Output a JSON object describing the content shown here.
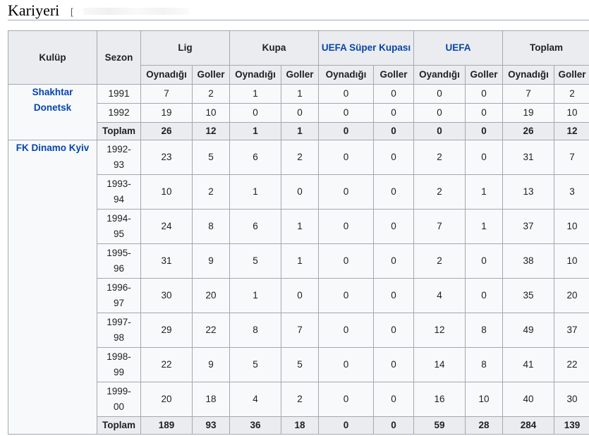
{
  "section": {
    "title": "Kariyeri",
    "edit_bracket": "["
  },
  "headers": {
    "club": "Kulüp",
    "season": "Sezon",
    "groups": [
      "Lig",
      "Kupa",
      "UEFA Süper Kupası",
      "UEFA",
      "Toplam"
    ],
    "sub": [
      "Oynadığı",
      "Goller",
      "Oynadığı",
      "Goller",
      "Oynadığı",
      "Goller",
      "Oyandığı",
      "Goller",
      "Oynadığı",
      "Goller"
    ]
  },
  "clubs": [
    {
      "name_lines": [
        "Shakhtar",
        "Donetsk"
      ],
      "seasons": [
        {
          "season": [
            "1991"
          ],
          "values": [
            "7",
            "2",
            "1",
            "1",
            "0",
            "0",
            "0",
            "0",
            "7",
            "2"
          ]
        },
        {
          "season": [
            "1992"
          ],
          "values": [
            "19",
            "10",
            "0",
            "0",
            "0",
            "0",
            "0",
            "0",
            "19",
            "10"
          ]
        }
      ],
      "total": {
        "label": "Toplam",
        "values": [
          "26",
          "12",
          "1",
          "1",
          "0",
          "0",
          "0",
          "0",
          "26",
          "12"
        ]
      }
    },
    {
      "name_lines": [
        "FK Dinamo Kyiv"
      ],
      "seasons": [
        {
          "season": [
            "1992-",
            "93"
          ],
          "values": [
            "23",
            "5",
            "6",
            "2",
            "0",
            "0",
            "2",
            "0",
            "31",
            "7"
          ]
        },
        {
          "season": [
            "1993-",
            "94"
          ],
          "values": [
            "10",
            "2",
            "1",
            "0",
            "0",
            "0",
            "2",
            "1",
            "13",
            "3"
          ]
        },
        {
          "season": [
            "1994-",
            "95"
          ],
          "values": [
            "24",
            "8",
            "6",
            "1",
            "0",
            "0",
            "7",
            "1",
            "37",
            "10"
          ]
        },
        {
          "season": [
            "1995-",
            "96"
          ],
          "values": [
            "31",
            "9",
            "5",
            "1",
            "0",
            "0",
            "2",
            "0",
            "38",
            "10"
          ]
        },
        {
          "season": [
            "1996-",
            "97"
          ],
          "values": [
            "30",
            "20",
            "1",
            "0",
            "0",
            "0",
            "4",
            "0",
            "35",
            "20"
          ]
        },
        {
          "season": [
            "1997-",
            "98"
          ],
          "values": [
            "29",
            "22",
            "8",
            "7",
            "0",
            "0",
            "12",
            "8",
            "49",
            "37"
          ]
        },
        {
          "season": [
            "1998-",
            "99"
          ],
          "values": [
            "22",
            "9",
            "5",
            "5",
            "0",
            "0",
            "14",
            "8",
            "41",
            "22"
          ]
        },
        {
          "season": [
            "1999-",
            "00"
          ],
          "values": [
            "20",
            "18",
            "4",
            "2",
            "0",
            "0",
            "16",
            "10",
            "40",
            "30"
          ]
        }
      ],
      "total": {
        "label": "Toplam",
        "values": [
          "189",
          "93",
          "36",
          "18",
          "0",
          "0",
          "59",
          "28",
          "284",
          "139"
        ]
      }
    }
  ],
  "colors": {
    "link": "#0645ad",
    "header_bg": "#eaecf0",
    "cell_bg": "#f8f9fa",
    "border": "#a2a9b1"
  }
}
